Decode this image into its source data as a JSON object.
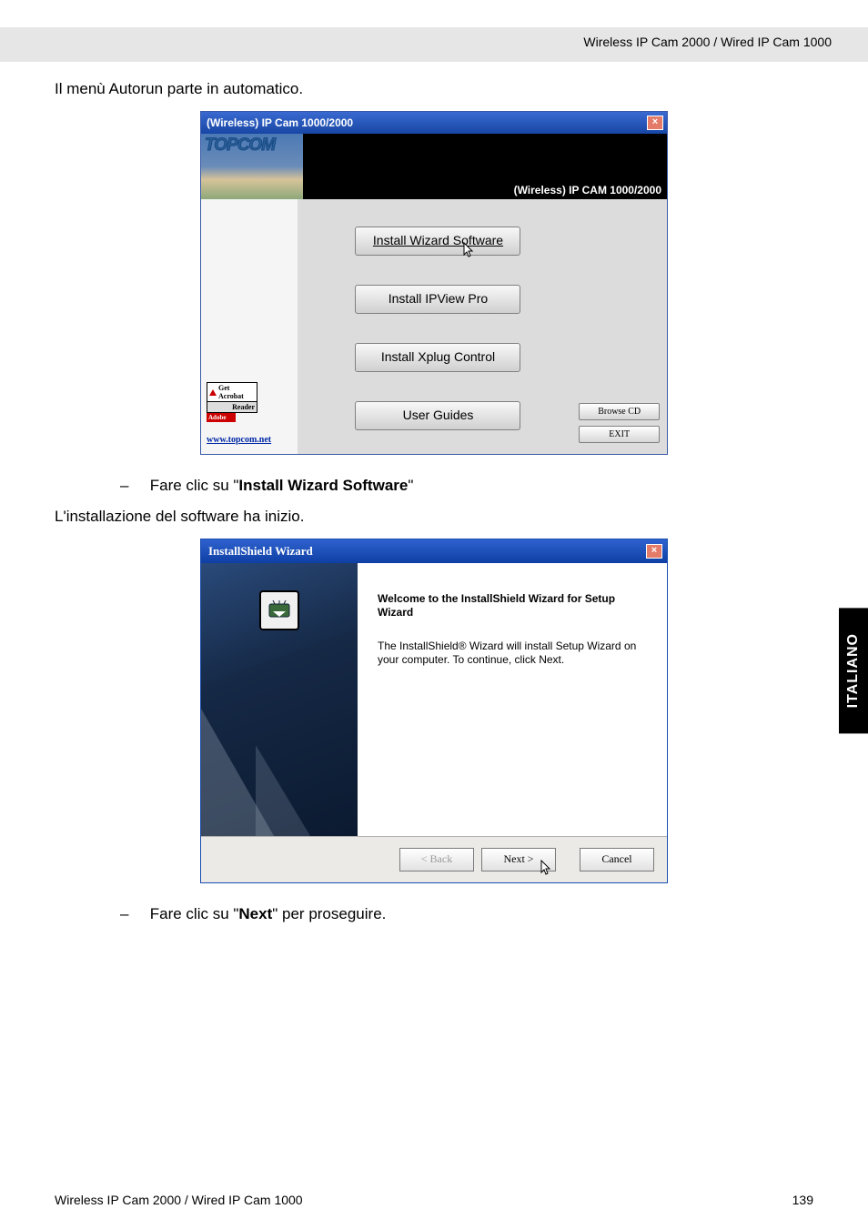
{
  "header": {
    "title": "Wireless IP Cam 2000 / Wired IP Cam 1000"
  },
  "text": {
    "p1": "Il menù Autorun parte in automatico.",
    "bullet1_pre": "Fare clic su \"",
    "bullet1_bold": "Install Wizard Software",
    "bullet1_post": "\"",
    "p2": "L'installazione del software ha inizio.",
    "bullet2_pre": "Fare clic su \"",
    "bullet2_bold": "Next",
    "bullet2_post": "\" per proseguire."
  },
  "autorun": {
    "title": "(Wireless) IP Cam 1000/2000",
    "logo": "TOPCOM",
    "banner_right": "(Wireless) IP CAM 1000/2000",
    "buttons": {
      "install_wizard": "Install Wizard Software",
      "install_ipview": "Install IPView Pro",
      "install_xplug": "Install Xplug Control",
      "user_guides": "User Guides"
    },
    "acrobat": {
      "line1": "Get Acrobat",
      "line2": "Reader",
      "adobe": "Adobe"
    },
    "link": "www.topcom.net",
    "side": {
      "browse": "Browse CD",
      "exit": "EXIT"
    }
  },
  "installshield": {
    "title": "InstallShield Wizard",
    "heading": "Welcome to the InstallShield Wizard for Setup Wizard",
    "para": "The InstallShield® Wizard will install Setup Wizard on your computer.  To continue, click Next.",
    "buttons": {
      "back": "< Back",
      "next": "Next >",
      "cancel": "Cancel"
    }
  },
  "sidebar": {
    "label": "ITALIANO"
  },
  "footer": {
    "left": "Wireless IP Cam 2000 / Wired IP Cam 1000",
    "page": "139"
  }
}
